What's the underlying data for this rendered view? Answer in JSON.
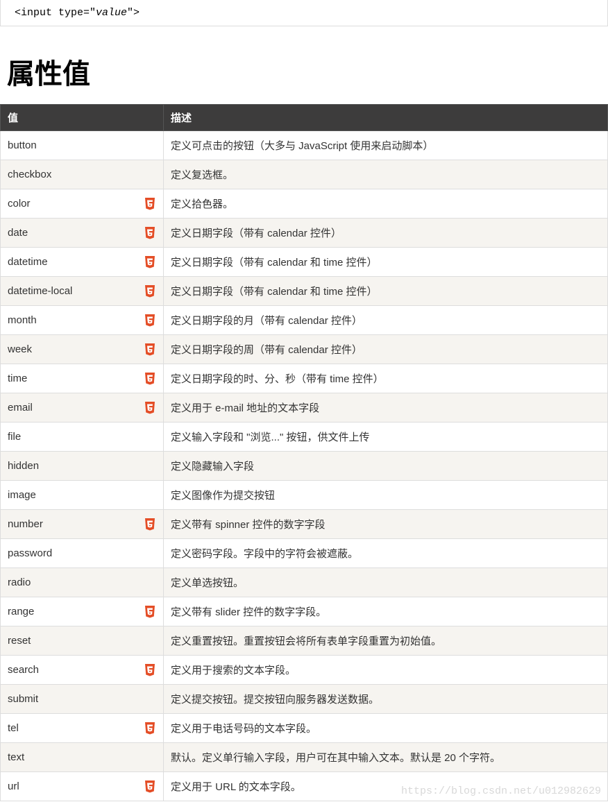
{
  "code_block": {
    "prefix": "<input type=\"",
    "value": "value",
    "suffix": "\">"
  },
  "section_title": "属性值",
  "table": {
    "headers": {
      "value": "值",
      "desc": "描述"
    },
    "rows": [
      {
        "value": "button",
        "html5": false,
        "desc": "定义可点击的按钮（大多与 JavaScript 使用来启动脚本）"
      },
      {
        "value": "checkbox",
        "html5": false,
        "desc": "定义复选框。"
      },
      {
        "value": "color",
        "html5": true,
        "desc": "定义拾色器。"
      },
      {
        "value": "date",
        "html5": true,
        "desc": "定义日期字段（带有 calendar 控件）"
      },
      {
        "value": "datetime",
        "html5": true,
        "desc": "定义日期字段（带有 calendar 和 time 控件）"
      },
      {
        "value": "datetime-local",
        "html5": true,
        "desc": "定义日期字段（带有 calendar 和 time 控件）"
      },
      {
        "value": "month",
        "html5": true,
        "desc": "定义日期字段的月（带有 calendar 控件）"
      },
      {
        "value": "week",
        "html5": true,
        "desc": "定义日期字段的周（带有 calendar 控件）"
      },
      {
        "value": "time",
        "html5": true,
        "desc": "定义日期字段的时、分、秒（带有 time 控件）"
      },
      {
        "value": "email",
        "html5": true,
        "desc": "定义用于 e-mail 地址的文本字段"
      },
      {
        "value": "file",
        "html5": false,
        "desc": "定义输入字段和 \"浏览...\" 按钮，供文件上传"
      },
      {
        "value": "hidden",
        "html5": false,
        "desc": "定义隐藏输入字段"
      },
      {
        "value": "image",
        "html5": false,
        "desc": "定义图像作为提交按钮"
      },
      {
        "value": "number",
        "html5": true,
        "desc": "定义带有 spinner 控件的数字字段"
      },
      {
        "value": "password",
        "html5": false,
        "desc": "定义密码字段。字段中的字符会被遮蔽。"
      },
      {
        "value": "radio",
        "html5": false,
        "desc": "定义单选按钮。"
      },
      {
        "value": "range",
        "html5": true,
        "desc": "定义带有 slider 控件的数字字段。"
      },
      {
        "value": "reset",
        "html5": false,
        "desc": "定义重置按钮。重置按钮会将所有表单字段重置为初始值。"
      },
      {
        "value": "search",
        "html5": true,
        "desc": "定义用于搜索的文本字段。"
      },
      {
        "value": "submit",
        "html5": false,
        "desc": "定义提交按钮。提交按钮向服务器发送数据。"
      },
      {
        "value": "tel",
        "html5": true,
        "desc": "定义用于电话号码的文本字段。"
      },
      {
        "value": "text",
        "html5": false,
        "desc": "默认。定义单行输入字段，用户可在其中输入文本。默认是 20 个字符。"
      },
      {
        "value": "url",
        "html5": true,
        "desc": "定义用于 URL 的文本字段。"
      }
    ]
  },
  "watermark": "https://blog.csdn.net/u012982629"
}
